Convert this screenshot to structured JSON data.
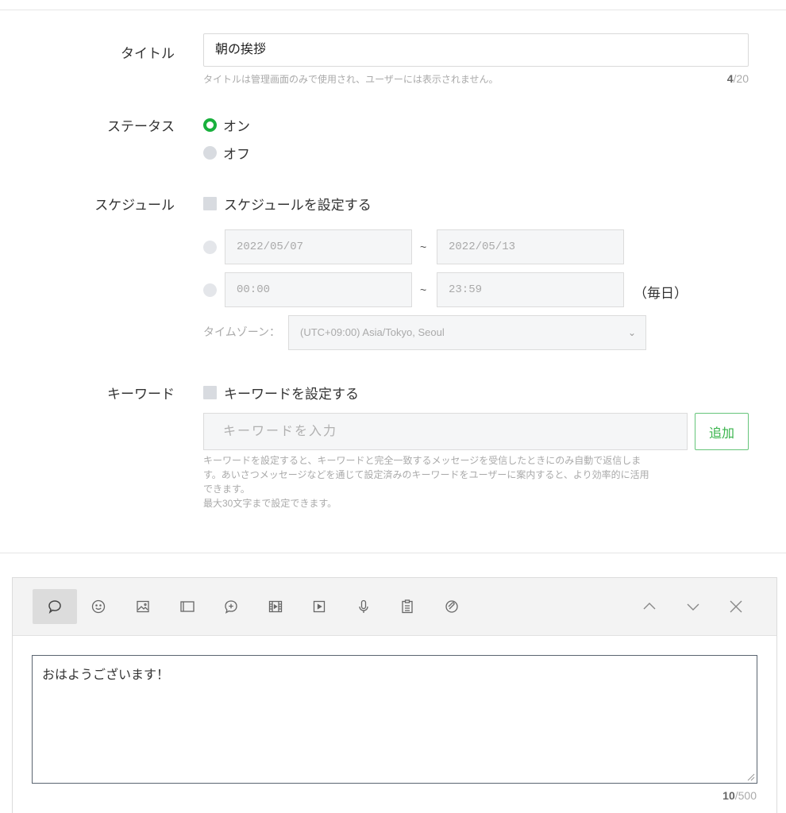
{
  "title_field": {
    "label": "タイトル",
    "value": "朝の挨拶",
    "help": "タイトルは管理画面のみで使用され、ユーザーには表示されません。",
    "count": "4",
    "max": "/20"
  },
  "status": {
    "label": "ステータス",
    "options": [
      "オン",
      "オフ"
    ],
    "selected": "オン"
  },
  "schedule": {
    "label": "スケジュール",
    "checkbox_label": "スケジュールを設定する",
    "date_from": "2022/05/07",
    "date_to": "2022/05/13",
    "time_from": "00:00",
    "time_to": "23:59",
    "tilde": "~",
    "daily": "（毎日）",
    "timezone_label": "タイムゾーン：",
    "timezone_value": "(UTC+09:00) Asia/Tokyo, Seoul"
  },
  "keyword": {
    "label": "キーワード",
    "checkbox_label": "キーワードを設定する",
    "placeholder": "キーワードを入力",
    "add_button": "追加",
    "help_line1": "キーワードを設定すると、キーワードと完全一致するメッセージを受信したときにのみ自動で返信しま",
    "help_line2": "す。あいさつメッセージなどを通じて設定済みのキーワードをユーザーに案内すると、より効率的に活用",
    "help_line3": "できます。",
    "help_line4": "最大30文字まで設定できます。"
  },
  "editor": {
    "tools": [
      "text-bubble-icon",
      "emoji-icon",
      "image-icon",
      "card-icon",
      "coupon-icon",
      "video-icon",
      "rich-video-icon",
      "voice-icon",
      "survey-icon",
      "link-icon"
    ],
    "message": "おはようございます！",
    "count": "10",
    "max": "/500"
  },
  "colors": {
    "accent_green": "#19b03d",
    "button_green": "#37b34a"
  }
}
